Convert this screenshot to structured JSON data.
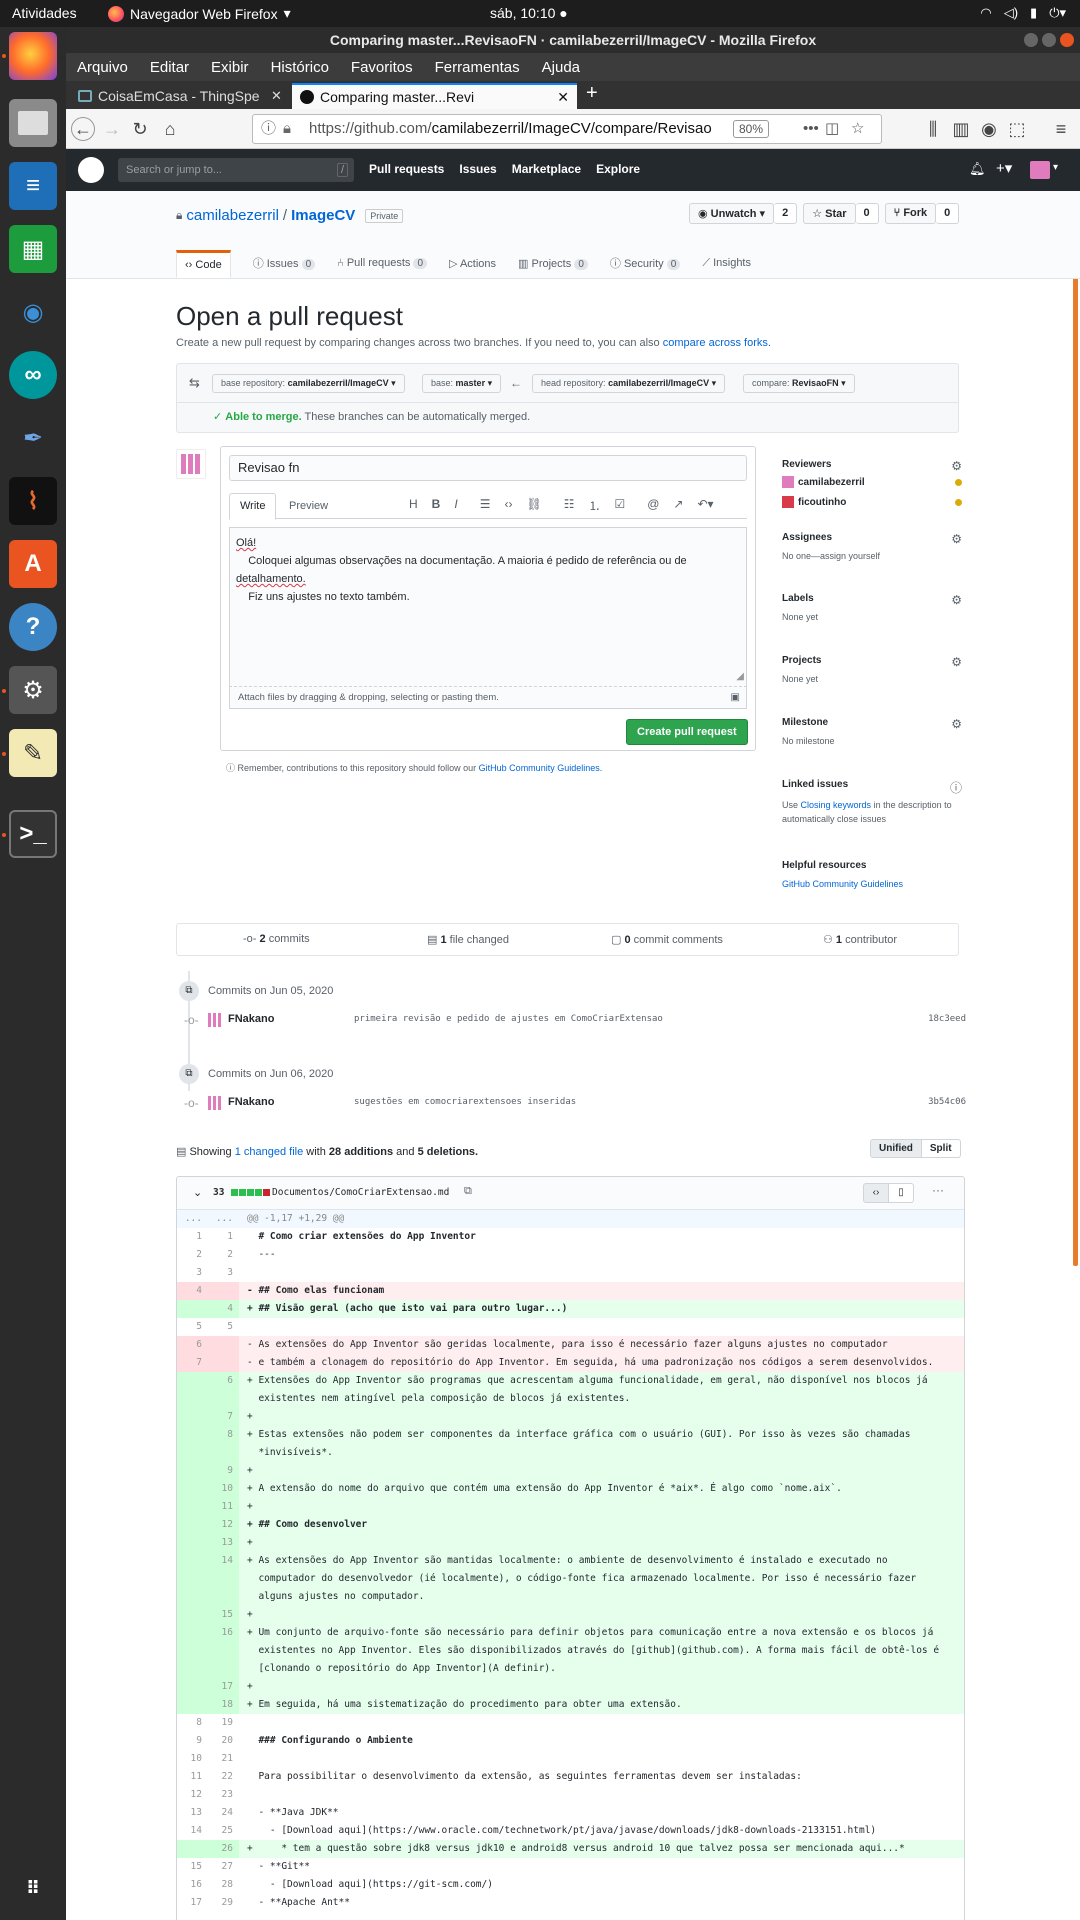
{
  "topbar": {
    "activities": "Atividades",
    "app": "Navegador Web Firefox",
    "clock": "sáb, 10:10"
  },
  "window": {
    "title": "Comparing master...RevisaoFN · camilabezerril/ImageCV - Mozilla Firefox"
  },
  "menu": [
    "Arquivo",
    "Editar",
    "Exibir",
    "Histórico",
    "Favoritos",
    "Ferramentas",
    "Ajuda"
  ],
  "tabs": [
    {
      "label": "CoisaEmCasa - ThingSpe"
    },
    {
      "label": "Comparing master...Revi"
    }
  ],
  "url": {
    "host": "https://github.com/",
    "path": "camilabezerril/ImageCV/compare/Revisao",
    "zoom": "80%"
  },
  "gh": {
    "search": "Search or jump to...",
    "slash": "/",
    "nav": [
      "Pull requests",
      "Issues",
      "Marketplace",
      "Explore"
    ],
    "owner": "camilabezerril",
    "sep": "/",
    "repo": "ImageCV",
    "private": "Private",
    "unwatch": "Unwatch",
    "unwatch_count": "2",
    "star": "Star",
    "star_count": "0",
    "fork": "Fork",
    "fork_count": "0",
    "repotabs": [
      {
        "label": "Code",
        "count": ""
      },
      {
        "label": "Issues",
        "count": "0"
      },
      {
        "label": "Pull requests",
        "count": "0"
      },
      {
        "label": "Actions",
        "count": ""
      },
      {
        "label": "Projects",
        "count": "0"
      },
      {
        "label": "Security",
        "count": "0"
      },
      {
        "label": "Insights",
        "count": ""
      }
    ],
    "heading": "Open a pull request",
    "subheading": "Create a new pull request by comparing changes across two branches. If you need to, you can also",
    "subheading_link": "compare across forks.",
    "base_repo_label": "base repository:",
    "base_repo": "camilabezerril/ImageCV",
    "base_label": "base:",
    "base": "master",
    "head_repo_label": "head repository:",
    "head_repo": "camilabezerril/ImageCV",
    "compare_label": "compare:",
    "compare": "RevisaoFN",
    "merge_ok": "Able to merge.",
    "merge_text": "These branches can be automatically merged.",
    "pr_title": "Revisao fn",
    "write": "Write",
    "preview": "Preview",
    "body": [
      "Olá!",
      "    Coloquei algumas observações na documentação. A maioria é pedido de referência ou de",
      "detalhamento.",
      "    Fiz uns ajustes no texto também."
    ],
    "attach": "Attach files by dragging & dropping, selecting or pasting them.",
    "create_btn": "Create pull request",
    "remember": "Remember, contributions to this repository should follow our",
    "remember_link": "GitHub Community Guidelines.",
    "sidebar": {
      "reviewers": "Reviewers",
      "reviewer1": "camilabezerril",
      "reviewer2": "ficoutinho",
      "assignees": "Assignees",
      "assignees_text": "No one—assign yourself",
      "labels": "Labels",
      "labels_text": "None yet",
      "projects": "Projects",
      "projects_text": "None yet",
      "milestone": "Milestone",
      "milestone_text": "No milestone",
      "linked": "Linked issues",
      "linked_pre": "Use",
      "linked_link": "Closing keywords",
      "linked_post": "in the description to automatically close issues",
      "helpful": "Helpful resources",
      "helpful_link": "GitHub Community Guidelines"
    },
    "stats": {
      "commits_n": "2",
      "commits": "commits",
      "files_n": "1",
      "files": "file changed",
      "comments_n": "0",
      "comments": "commit comments",
      "contrib_n": "1",
      "contrib": "contributor"
    },
    "commit_groups": [
      {
        "date": "Commits on Jun 05, 2020",
        "author": "FNakano",
        "message": "primeira revisão e pedido de ajustes em ComoCriarExtensao",
        "sha": "18c3eed"
      },
      {
        "date": "Commits on Jun 06, 2020",
        "author": "FNakano",
        "message": "sugestões em comocriarextensoes inseridas",
        "sha": "3b54c06"
      }
    ],
    "showing": "Showing",
    "showing_link": "1 changed file",
    "showing_with": "with",
    "additions": "28 additions",
    "and": "and",
    "deletions": "5 deletions.",
    "unified": "Unified",
    "split": "Split",
    "file_count": "33",
    "file_name": "Documentos/ComoCriarExtensao.md",
    "hunk": "@@ -1,17 +1,29 @@",
    "hunk_dots": "...",
    "diff": [
      {
        "t": "ctx",
        "o": "1",
        "n": "1",
        "c": "  # Como criar extensões do App Inventor"
      },
      {
        "t": "ctx",
        "o": "2",
        "n": "2",
        "c": "  ---"
      },
      {
        "t": "ctx",
        "o": "3",
        "n": "3",
        "c": ""
      },
      {
        "t": "del",
        "o": "4",
        "n": "",
        "c": "- ## Como elas funcionam"
      },
      {
        "t": "add",
        "o": "",
        "n": "4",
        "c": "+ ## Visão geral (acho que isto vai para outro lugar...)"
      },
      {
        "t": "ctx",
        "o": "5",
        "n": "5",
        "c": ""
      },
      {
        "t": "del",
        "o": "6",
        "n": "",
        "c": "- As extensões do App Inventor são geridas localmente, para isso é necessário fazer alguns ajustes no computador"
      },
      {
        "t": "del",
        "o": "7",
        "n": "",
        "c": "- e também a clonagem do repositório do App Inventor. Em seguida, há uma padronização nos códigos a serem desenvolvidos."
      },
      {
        "t": "add",
        "o": "",
        "n": "6",
        "c": "+ Extensões do App Inventor são programas que acrescentam alguma funcionalidade, em geral, não disponível nos blocos já\n  existentes nem atingível pela composição de blocos já existentes."
      },
      {
        "t": "add",
        "o": "",
        "n": "7",
        "c": "+"
      },
      {
        "t": "add",
        "o": "",
        "n": "8",
        "c": "+ Estas extensões não podem ser componentes da interface gráfica com o usuário (GUI). Por isso às vezes são chamadas\n  *invisíveis*."
      },
      {
        "t": "add",
        "o": "",
        "n": "9",
        "c": "+"
      },
      {
        "t": "add",
        "o": "",
        "n": "10",
        "c": "+ A extensão do nome do arquivo que contém uma extensão do App Inventor é *aix*. É algo como `nome.aix`."
      },
      {
        "t": "add",
        "o": "",
        "n": "11",
        "c": "+"
      },
      {
        "t": "add",
        "o": "",
        "n": "12",
        "c": "+ ## Como desenvolver"
      },
      {
        "t": "add",
        "o": "",
        "n": "13",
        "c": "+"
      },
      {
        "t": "add",
        "o": "",
        "n": "14",
        "c": "+ As extensões do App Inventor são mantidas localmente: o ambiente de desenvolvimento é instalado e executado no\n  computador do desenvolvedor (ié localmente), o código-fonte fica armazenado localmente. Por isso é necessário fazer\n  alguns ajustes no computador."
      },
      {
        "t": "add",
        "o": "",
        "n": "15",
        "c": "+"
      },
      {
        "t": "add",
        "o": "",
        "n": "16",
        "c": "+ Um conjunto de arquivo-fonte são necessário para definir objetos para comunicação entre a nova extensão e os blocos já\n  existentes no App Inventor. Eles são disponibilizados através do [github](github.com). A forma mais fácil de obtê-los é\n  [clonando o repositório do App Inventor](A definir)."
      },
      {
        "t": "add",
        "o": "",
        "n": "17",
        "c": "+"
      },
      {
        "t": "add",
        "o": "",
        "n": "18",
        "c": "+ Em seguida, há uma sistematização do procedimento para obter uma extensão."
      },
      {
        "t": "ctx",
        "o": "8",
        "n": "19",
        "c": ""
      },
      {
        "t": "ctx",
        "o": "9",
        "n": "20",
        "c": "  ### Configurando o Ambiente"
      },
      {
        "t": "ctx",
        "o": "10",
        "n": "21",
        "c": ""
      },
      {
        "t": "ctx",
        "o": "11",
        "n": "22",
        "c": "  Para possibilitar o desenvolvimento da extensão, as seguintes ferramentas devem ser instaladas:"
      },
      {
        "t": "ctx",
        "o": "12",
        "n": "23",
        "c": ""
      },
      {
        "t": "ctx",
        "o": "13",
        "n": "24",
        "c": "  - **Java JDK**"
      },
      {
        "t": "ctx",
        "o": "14",
        "n": "25",
        "c": "    - [Download aqui](https://www.oracle.com/technetwork/pt/java/javase/downloads/jdk8-downloads-2133151.html)"
      },
      {
        "t": "add",
        "o": "",
        "n": "26",
        "c": "+     * tem a questão sobre jdk8 versus jdk10 e android8 versus android 10 que talvez possa ser mencionada aqui...*"
      },
      {
        "t": "ctx",
        "o": "15",
        "n": "27",
        "c": "  - **Git**"
      },
      {
        "t": "ctx",
        "o": "16",
        "n": "28",
        "c": "    - [Download aqui](https://git-scm.com/)"
      },
      {
        "t": "ctx",
        "o": "17",
        "n": "29",
        "c": "  - **Apache Ant**"
      }
    ]
  }
}
